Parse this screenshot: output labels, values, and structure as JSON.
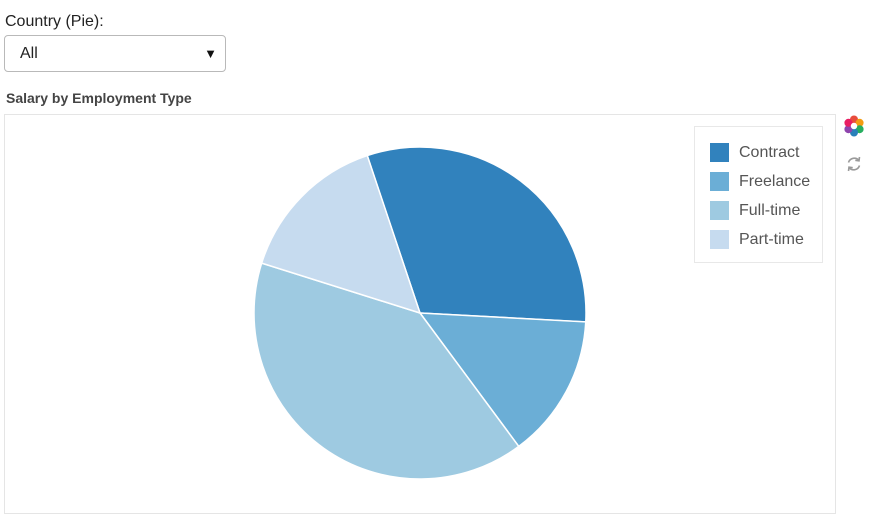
{
  "filter": {
    "label": "Country (Pie):",
    "selected": "All"
  },
  "chart_data": {
    "type": "pie",
    "title": "Salary by Employment Type",
    "categories": [
      "Contract",
      "Freelance",
      "Full-time",
      "Part-time"
    ],
    "values": [
      31,
      14,
      40,
      15
    ],
    "colors": [
      "#3182bd",
      "#6baed6",
      "#9ecae1",
      "#c6dbef"
    ],
    "legend": "top-right"
  },
  "toolbar": {
    "icons": [
      "color-palette-icon",
      "refresh-icon"
    ]
  }
}
